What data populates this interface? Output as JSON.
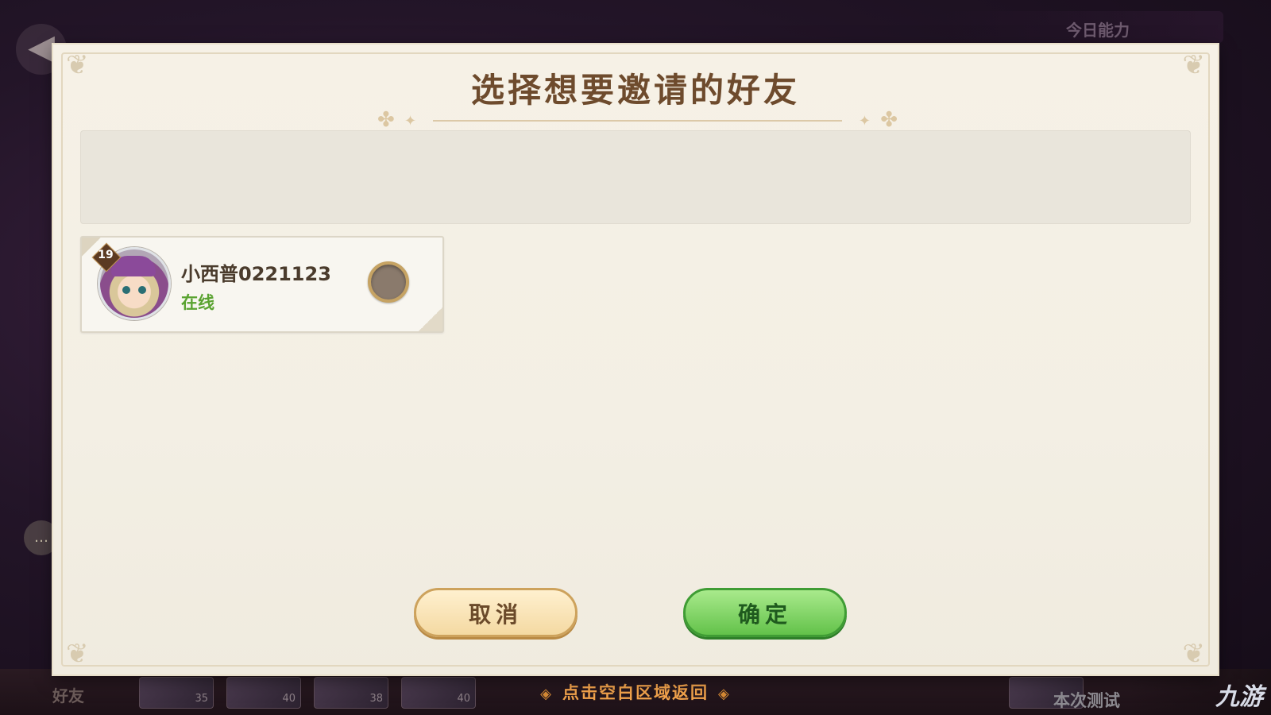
{
  "background": {
    "top_right_label": "今日能力",
    "back_icon": "back-arrow-icon",
    "side_icon": "chat-icon",
    "bottom_label": "好友",
    "thumb_levels": [
      "35",
      "40",
      "38",
      "40",
      ""
    ],
    "test_label": "本次测试"
  },
  "dialog": {
    "title": "选择想要邀请的好友",
    "search_placeholder": ""
  },
  "friends": [
    {
      "name": "小西普0221123",
      "status": "在线",
      "level": "19",
      "selected": false
    }
  ],
  "buttons": {
    "cancel_label": "取消",
    "confirm_label": "确定"
  },
  "hint": {
    "text": "点击空白区域返回"
  },
  "watermark": {
    "logo_text": "九游"
  },
  "colors": {
    "title": "#6e4b2d",
    "status_online": "#5aa331",
    "confirm_button": "#63c24a",
    "cancel_button": "#f4d9a2",
    "hint_text": "#f2a34c"
  }
}
